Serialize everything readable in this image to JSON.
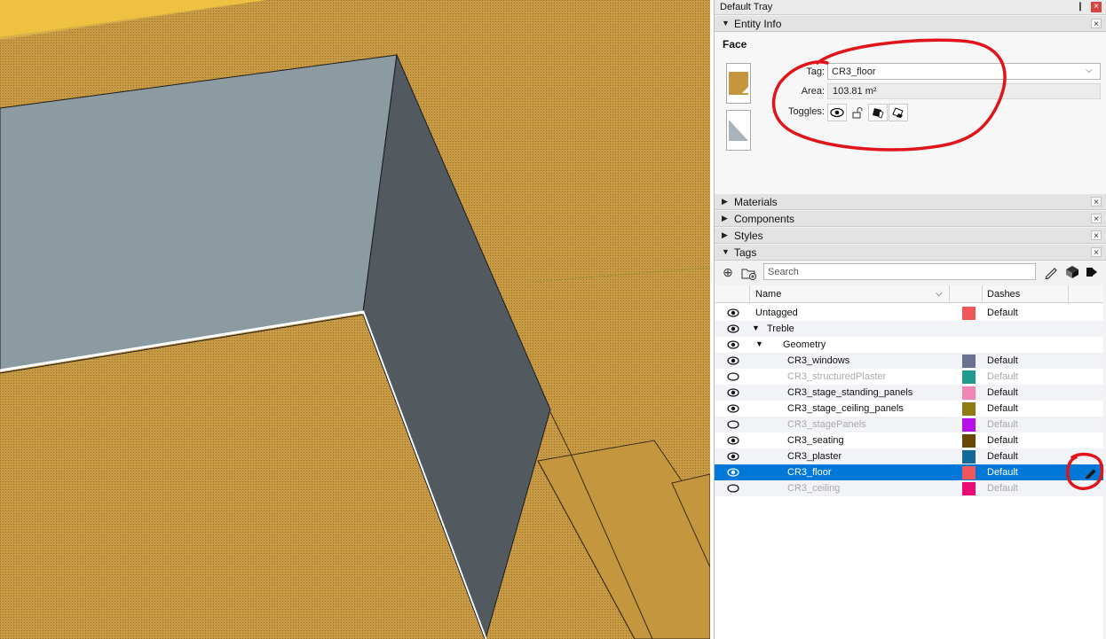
{
  "tray": {
    "title": "Default Tray",
    "pin_glyph": "❙",
    "close_glyph": "×"
  },
  "entity_info": {
    "section_label": "Entity Info",
    "kind": "Face",
    "tag_label": "Tag:",
    "tag_value": "CR3_floor",
    "area_label": "Area:",
    "area_value": "103.81 m²",
    "toggles_label": "Toggles:",
    "toggle_icons": [
      "eye-icon",
      "lock-icon",
      "cast-shadows-icon",
      "receive-shadows-icon"
    ],
    "front_material_color": "#c4963e",
    "back_material_color": "#a9b4bd"
  },
  "sections": [
    {
      "label": "Materials",
      "expanded": false
    },
    {
      "label": "Components",
      "expanded": false
    },
    {
      "label": "Styles",
      "expanded": false
    },
    {
      "label": "Tags",
      "expanded": true
    }
  ],
  "tags": {
    "search_placeholder": "Search",
    "col_name": "Name",
    "col_dashes": "Dashes",
    "rows": [
      {
        "name": "Untagged",
        "indent": 0,
        "visible": true,
        "color": "#f0575a",
        "dashes": "Default",
        "tree": ""
      },
      {
        "name": "Treble",
        "indent": 1,
        "visible": true,
        "color": "",
        "dashes": "",
        "tree": "▼"
      },
      {
        "name": "Geometry",
        "indent": 2,
        "visible": true,
        "color": "",
        "dashes": "",
        "tree": "▼"
      },
      {
        "name": "CR3_windows",
        "indent": 3,
        "visible": true,
        "color": "#6c7191",
        "dashes": "Default",
        "tree": ""
      },
      {
        "name": "CR3_structuredPlaster",
        "indent": 3,
        "visible": false,
        "color": "#1f9a8c",
        "dashes": "Default",
        "tree": ""
      },
      {
        "name": "CR3_stage_standing_panels",
        "indent": 3,
        "visible": true,
        "color": "#ef86b3",
        "dashes": "Default",
        "tree": ""
      },
      {
        "name": "CR3_stage_ceiling_panels",
        "indent": 3,
        "visible": true,
        "color": "#8e7b12",
        "dashes": "Default",
        "tree": ""
      },
      {
        "name": "CR3_stagePanels",
        "indent": 3,
        "visible": false,
        "color": "#b50ee6",
        "dashes": "Default",
        "tree": ""
      },
      {
        "name": "CR3_seating",
        "indent": 3,
        "visible": true,
        "color": "#6a4605",
        "dashes": "Default",
        "tree": ""
      },
      {
        "name": "CR3_plaster",
        "indent": 3,
        "visible": true,
        "color": "#116a97",
        "dashes": "Default",
        "tree": ""
      },
      {
        "name": "CR3_floor",
        "indent": 3,
        "visible": true,
        "color": "#f0575a",
        "dashes": "Default",
        "tree": "",
        "selected": true
      },
      {
        "name": "CR3_ceiling",
        "indent": 3,
        "visible": false,
        "color": "#ea0a74",
        "dashes": "Default",
        "tree": ""
      }
    ]
  },
  "colors": {
    "accent_selected": "#0078d7",
    "annotation_red": "#e0141b",
    "ground": "#c4963e",
    "wall_light": "#8c9aa2",
    "wall_dark": "#525a5f",
    "roof_yellow": "#eec240"
  }
}
